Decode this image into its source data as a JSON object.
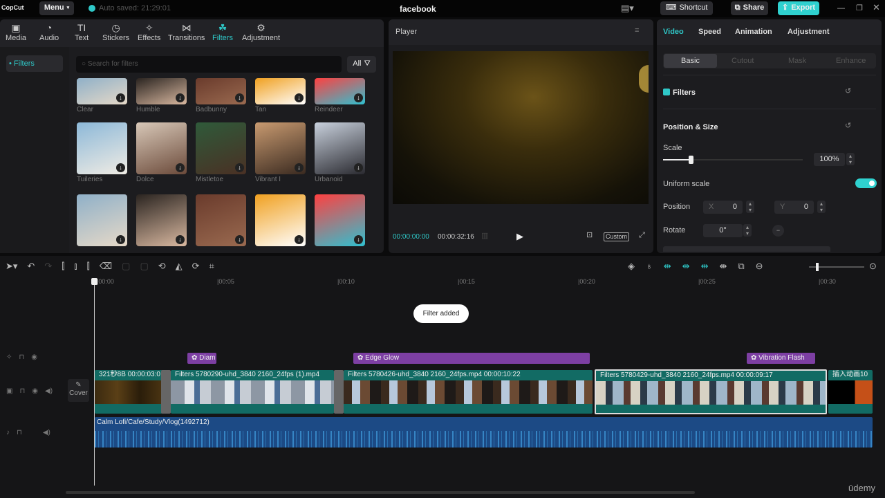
{
  "titlebar": {
    "logo": "CopCut",
    "menu": "Menu",
    "autosave": "Auto saved: 21:29:01",
    "project_title": "facebook",
    "shortcut": "Shortcut",
    "share": "Share",
    "export": "Export"
  },
  "toolbar_tabs": [
    {
      "label": "Media",
      "icon": "▣"
    },
    {
      "label": "Audio",
      "icon": "◔"
    },
    {
      "label": "Text",
      "icon": "TI"
    },
    {
      "label": "Stickers",
      "icon": "◷"
    },
    {
      "label": "Effects",
      "icon": "✧"
    },
    {
      "label": "Transitions",
      "icon": "⋈"
    },
    {
      "label": "Filters",
      "icon": "☘"
    },
    {
      "label": "Adjustment",
      "icon": "⚙"
    }
  ],
  "filters": {
    "sidebar_item": "Filters",
    "search_placeholder": "Search for filters",
    "all_label": "All",
    "row1": [
      "Clear",
      "Humble",
      "Badbunny",
      "Tan",
      "Reindeer"
    ],
    "row2": [
      "Tuileries",
      "Dolce",
      "Mistletoe",
      "Vibrant I",
      "Urbanoid"
    ]
  },
  "player": {
    "title": "Player",
    "current_time": "00:00:00:00",
    "total_time": "00:00:32:16",
    "ratio": "Custom"
  },
  "inspector": {
    "tabs": [
      "Video",
      "Speed",
      "Animation",
      "Adjustment"
    ],
    "subtabs": [
      "Basic",
      "Cutout",
      "Mask",
      "Enhance"
    ],
    "filters_label": "Filters",
    "position_size": "Position & Size",
    "scale_label": "Scale",
    "scale_value": "100%",
    "scale_fraction": 0.2,
    "uniform_scale": "Uniform scale",
    "uniform_scale_on": true,
    "position_label": "Position",
    "x_label": "X",
    "x_value": "0",
    "y_label": "Y",
    "y_value": "0",
    "rotate_label": "Rotate",
    "rotate_value": "0°"
  },
  "timeline": {
    "ticks": [
      "00:00",
      "00:05",
      "00:10",
      "00:15",
      "00:20",
      "00:25",
      "00:30"
    ],
    "toast": "Filter added",
    "cover": "Cover",
    "effects": [
      "Diam",
      "Edge Glow",
      "Vibration Flash"
    ],
    "clips": [
      {
        "title": "321秒8B  00:00:03:0"
      },
      {
        "title": "Filters  5780290-uhd_3840 2160_24fps (1).mp4"
      },
      {
        "title": "Filters  5780426-uhd_3840 2160_24fps.mp4  00:00:10:22"
      },
      {
        "title": "Filters  5780429-uhd_3840 2160_24fps.mp4  00:00:09:17"
      },
      {
        "title": "插入动画10"
      }
    ],
    "audio": "Calm Lofi/Cafe/Study/Vlog(1492712)"
  },
  "watermark": "ūdemy",
  "colors": {
    "accent": "#2fc8c8",
    "effect": "#7d3fa3",
    "clip": "#126b64",
    "audio": "#1c4a85"
  }
}
